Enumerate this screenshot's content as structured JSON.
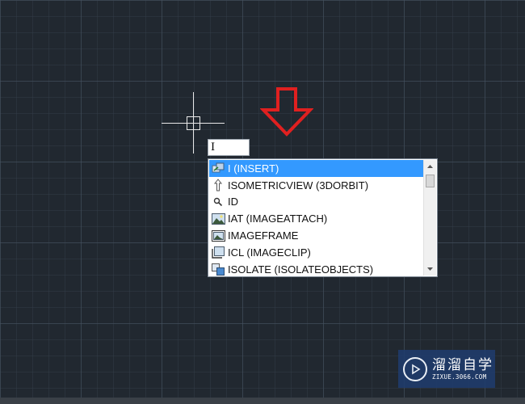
{
  "command_input": {
    "value": "I"
  },
  "autocomplete": {
    "items": [
      {
        "label": "I (INSERT)",
        "icon": "insert-block-icon",
        "selected": true
      },
      {
        "label": "ISOMETRICVIEW (3DORBIT)",
        "icon": "isometric-arrow-icon",
        "selected": false
      },
      {
        "label": "ID",
        "icon": "id-point-icon",
        "selected": false
      },
      {
        "label": "IAT (IMAGEATTACH)",
        "icon": "image-attach-icon",
        "selected": false
      },
      {
        "label": "IMAGEFRAME",
        "icon": "image-frame-icon",
        "selected": false
      },
      {
        "label": "ICL (IMAGECLIP)",
        "icon": "image-clip-icon",
        "selected": false
      },
      {
        "label": "ISOLATE (ISOLATEOBJECTS)",
        "icon": "isolate-objects-icon",
        "selected": false
      }
    ],
    "scroll_position": 0
  },
  "colors": {
    "background": "#212830",
    "selection": "#3399ff",
    "arrow": "#e02020",
    "crosshair": "#e8e8e8"
  },
  "watermark": {
    "title": "溜溜自学",
    "url": "ZIXUE.3066.COM"
  }
}
